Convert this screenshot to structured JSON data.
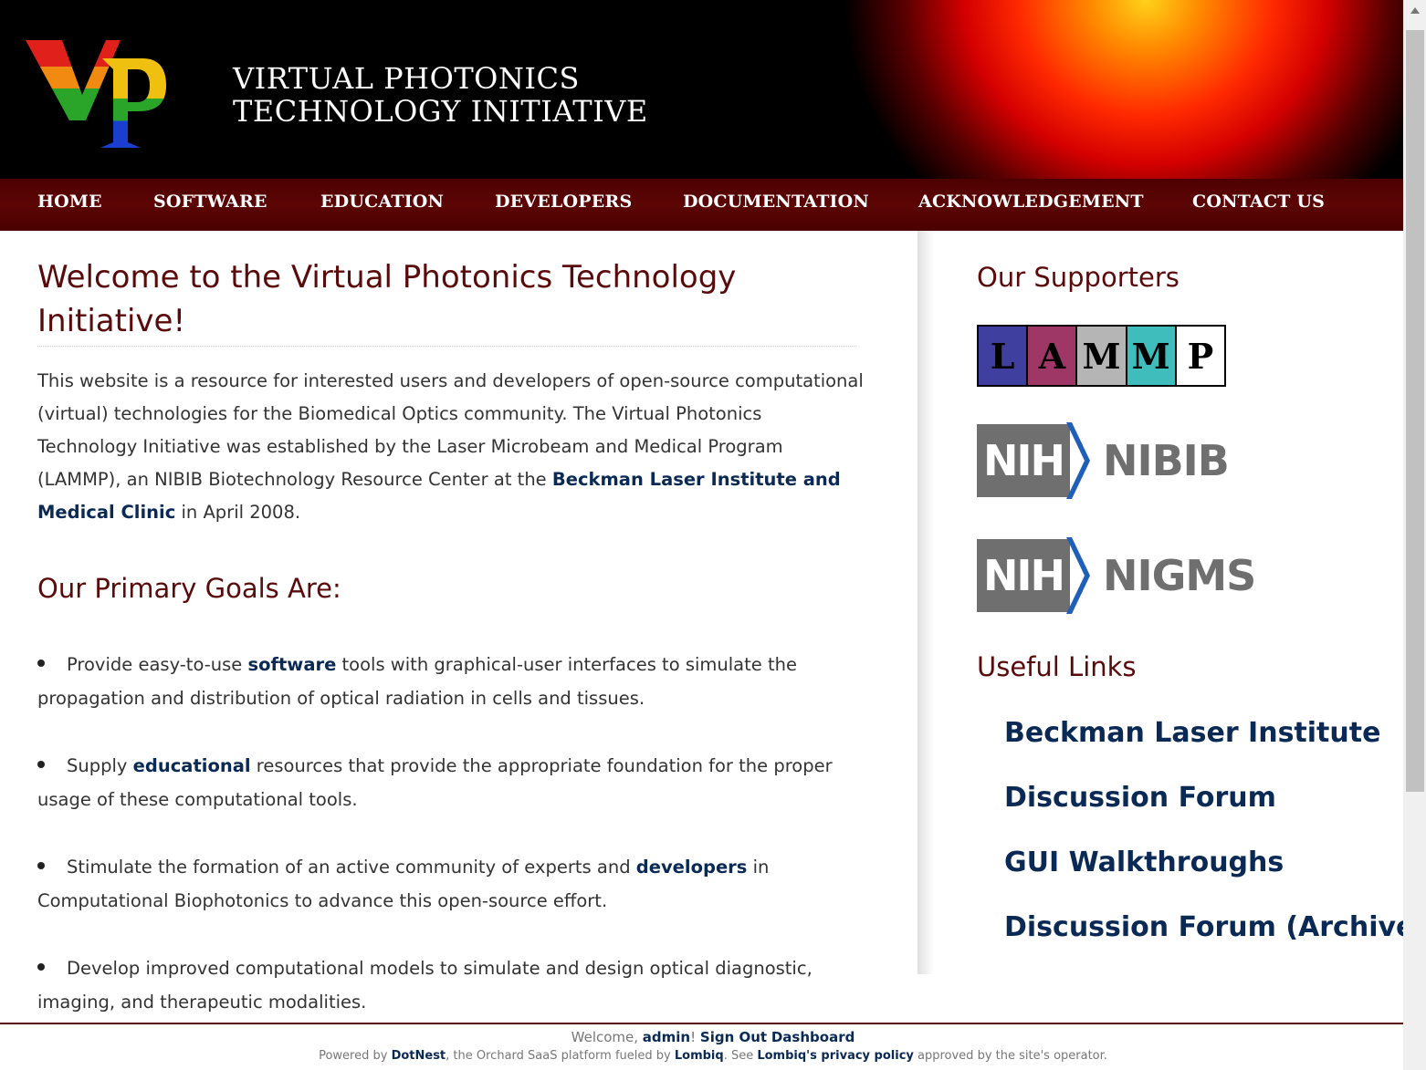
{
  "site": {
    "logo_alt": "VP",
    "title_line1": "VIRTUAL PHOTONICS",
    "title_line2": "TECHNOLOGY INITIATIVE"
  },
  "nav": {
    "items": [
      {
        "label": "HOME"
      },
      {
        "label": "SOFTWARE"
      },
      {
        "label": "EDUCATION"
      },
      {
        "label": "DEVELOPERS"
      },
      {
        "label": "DOCUMENTATION"
      },
      {
        "label": "ACKNOWLEDGEMENT"
      },
      {
        "label": "CONTACT US"
      }
    ]
  },
  "main": {
    "title": "Welcome to the Virtual Photonics Technology Initiative!",
    "intro_before": "This website is a resource for interested users and developers of open-source computational (virtual) technologies for the Biomedical Optics community. The Virtual Photonics Technology Initiative was established by the Laser Microbeam and Medical Program (LAMMP), an NIBIB Biotechnology Resource Center at the ",
    "intro_link": "Beckman Laser Institute and Medical Clinic",
    "intro_after": " in April 2008.",
    "goals_heading": "Our Primary Goals Are:",
    "goals": [
      {
        "before": "Provide easy-to-use ",
        "link": "software",
        "after": " tools with graphical-user interfaces to simulate the propagation and distribution of optical radiation in cells and tissues."
      },
      {
        "before": "Supply ",
        "link": "educational",
        "after": " resources that provide the appropriate foundation for the proper usage of these computational tools."
      },
      {
        "before": "Stimulate the formation of an active community of experts and ",
        "link": "developers",
        "after": " in Computational Biophotonics to advance this open-source effort."
      },
      {
        "before": "Develop improved computational models to simulate and design optical diagnostic, imaging, and therapeutic modalities.",
        "link": "",
        "after": ""
      }
    ]
  },
  "sidebar": {
    "supporters_heading": "Our Supporters",
    "lammp_letters": [
      "L",
      "A",
      "M",
      "M",
      "P"
    ],
    "lammp_colors": [
      "#3f3f9f",
      "#9e3766",
      "#b5b5b5",
      "#3fbcbc",
      "#ffffff"
    ],
    "nih_prefix": "NIH",
    "nih_nibib": "NIBIB",
    "nih_nigms": "NIGMS",
    "useful_heading": "Useful Links",
    "links": [
      {
        "label": "Beckman Laser Institute"
      },
      {
        "label": "Discussion Forum"
      },
      {
        "label": "GUI Walkthroughs"
      },
      {
        "label": "Discussion Forum (Archive)"
      }
    ]
  },
  "footer": {
    "welcome_prefix": "Welcome, ",
    "user": "admin",
    "exclaim": "! ",
    "sign_out": "Sign Out",
    "dashboard": "Dashboard",
    "powered_prefix": "Powered by ",
    "dotnest": "DotNest",
    "powered_mid": ", the Orchard SaaS platform fueled by ",
    "lombiq": "Lombiq",
    "see": ". See ",
    "privacy": "Lombiq's privacy policy",
    "approved": " approved by the site's operator."
  },
  "colors": {
    "accent_dark_red": "#5a0a0a",
    "link_navy": "#0a2a55",
    "nav_bg": "#4d0000"
  }
}
